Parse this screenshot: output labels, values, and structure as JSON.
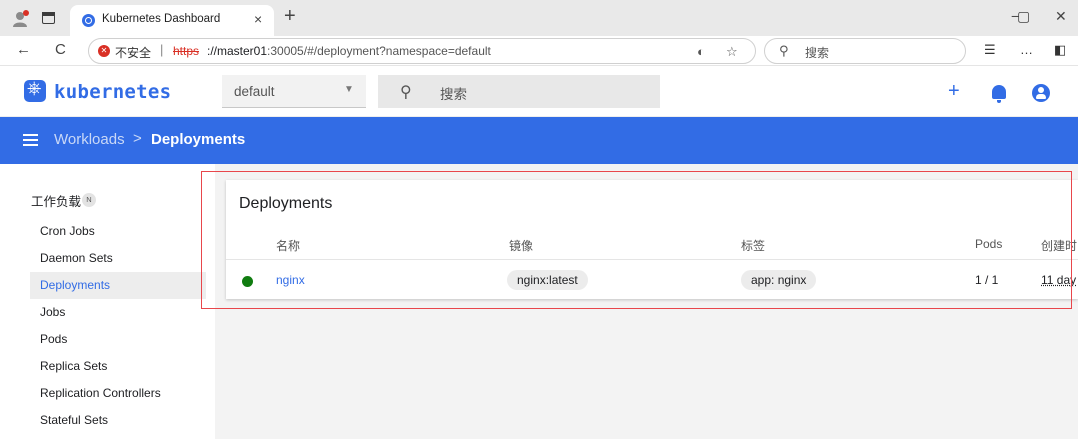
{
  "browser": {
    "tab_title": "Kubernetes Dashboard",
    "tab_close": "×",
    "new_tab": "+",
    "win_min": "−",
    "win_max": "▢",
    "win_close": "✕",
    "back": "←",
    "reload": "C",
    "insecure_label": "不安全",
    "url_sep": "|",
    "url_proto": "https",
    "url_host": "://master01",
    "url_path": ":30005/#/deployment?namespace=default",
    "search_placeholder": "搜索",
    "tools": [
      "☆",
      "…"
    ]
  },
  "app": {
    "brand": "kubernetes",
    "namespace": "default",
    "search_placeholder": "搜索",
    "add_icon": "+",
    "accent": "#326ce5"
  },
  "toolbar": {
    "breadcrumb_parent": "Workloads",
    "breadcrumb_sep": ">",
    "breadcrumb_current": "Deployments"
  },
  "sidebar": {
    "title": "工作负载",
    "badge": "N",
    "items": [
      {
        "label": "Cron Jobs"
      },
      {
        "label": "Daemon Sets"
      },
      {
        "label": "Deployments"
      },
      {
        "label": "Jobs"
      },
      {
        "label": "Pods"
      },
      {
        "label": "Replica Sets"
      },
      {
        "label": "Replication Controllers"
      },
      {
        "label": "Stateful Sets"
      }
    ]
  },
  "deployments": {
    "title": "Deployments",
    "columns": [
      "名称",
      "镜像",
      "标签",
      "Pods",
      "创建时"
    ],
    "rows": [
      {
        "name": "nginx",
        "image": "nginx:latest",
        "label": "app: nginx",
        "pods": "1 / 1",
        "age": "11 day"
      }
    ]
  }
}
